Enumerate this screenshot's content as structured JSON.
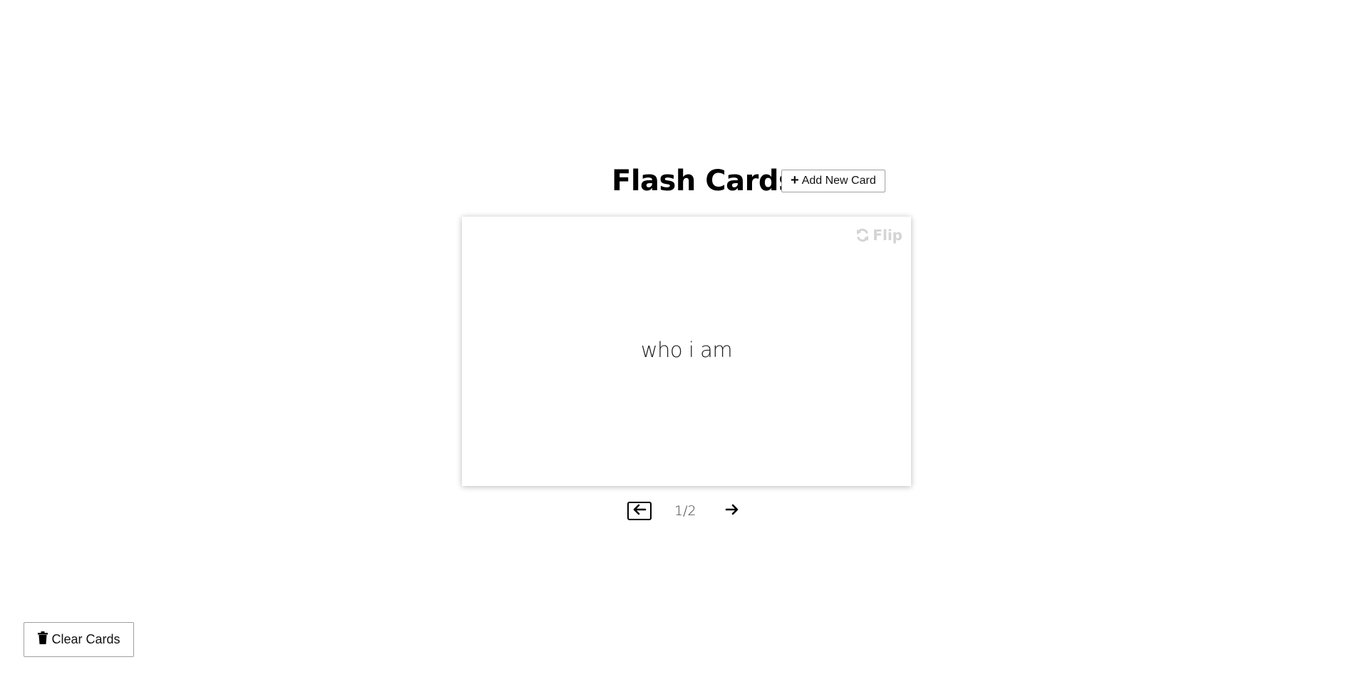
{
  "header": {
    "title": "Flash Cards",
    "add_button": {
      "icon": "plus-icon",
      "label": "Add New Card"
    }
  },
  "card": {
    "flip": {
      "icon": "refresh-icon",
      "label": "Flip"
    },
    "text": "who i am"
  },
  "navigation": {
    "prev_icon": "arrow-left-icon",
    "next_icon": "arrow-right-icon",
    "counter": "1/2"
  },
  "footer": {
    "clear_button": {
      "icon": "trash-icon",
      "label": "Clear Cards"
    }
  },
  "colors": {
    "flip_text": "#d4d4d4",
    "card_shadow": "rgba(0,0,0,0.28)",
    "button_border": "#a0a0a0"
  }
}
